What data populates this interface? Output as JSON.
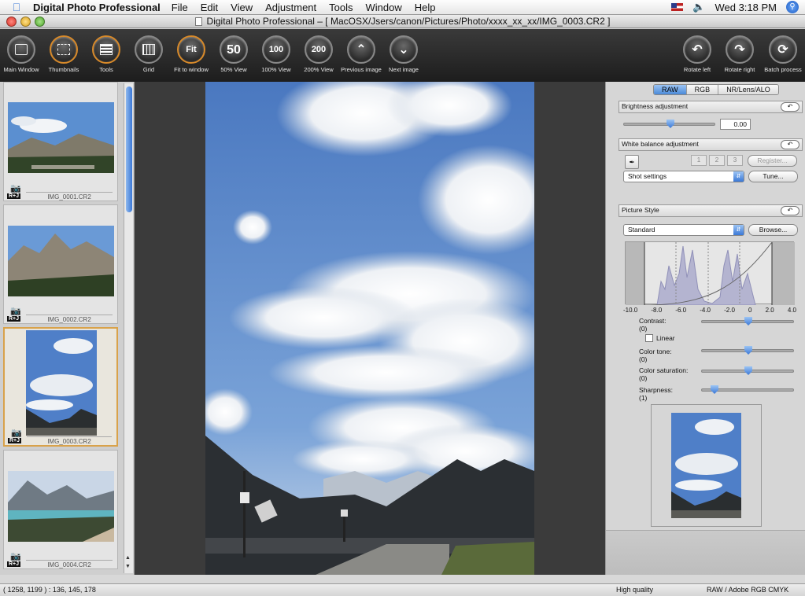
{
  "menubar": {
    "app_name": "Digital Photo Professional",
    "menus": [
      "File",
      "Edit",
      "View",
      "Adjustment",
      "Tools",
      "Window",
      "Help"
    ],
    "clock": "Wed 3:18 PM"
  },
  "window": {
    "title": "Digital Photo Professional – [ MacOSX/Jsers/canon/Pictures/Photo/xxxx_xx_xx/IMG_0003.CR2 ]"
  },
  "toolbar": {
    "main_window": "Main Window",
    "thumbnails": "Thumbnails",
    "tools": "Tools",
    "grid": "Grid",
    "fit_to_window": "Fit to window",
    "fit_glyph": "Fit",
    "view50": "50% View",
    "view50_glyph": "50",
    "view100": "100% View",
    "view100_glyph": "100",
    "view200": "200% View",
    "view200_glyph": "200",
    "previous_image": "Previous image",
    "next_image": "Next image",
    "rotate_left": "Rotate left",
    "rotate_right": "Rotate right",
    "batch_process": "Batch process"
  },
  "thumbnails": [
    {
      "filename": "IMG_0001.CR2",
      "badge": "R+J",
      "selected": false
    },
    {
      "filename": "IMG_0002.CR2",
      "badge": "R+J",
      "selected": false
    },
    {
      "filename": "IMG_0003.CR2",
      "badge": "R+J",
      "selected": true
    },
    {
      "filename": "IMG_0004.CR2",
      "badge": "R+J",
      "selected": false
    }
  ],
  "palette": {
    "tabs": [
      "RAW",
      "RGB",
      "NR/Lens/ALO"
    ],
    "active_tab": "RAW",
    "brightness": {
      "title": "Brightness adjustment",
      "value": "0.00",
      "level": 0.5
    },
    "white_balance": {
      "title": "White balance adjustment",
      "buttons": [
        "1",
        "2",
        "3"
      ],
      "register": "Register...",
      "mode": "Shot settings",
      "tune": "Tune..."
    },
    "picture_style": {
      "title": "Picture Style",
      "style": "Standard",
      "browse": "Browse...",
      "histogram_ticks": [
        "-10.0",
        "-8.0",
        "-6.0",
        "-4.0",
        "-2.0",
        "0",
        "2.0",
        "4.0"
      ],
      "contrast": {
        "label": "Contrast:",
        "value": "(0)",
        "level": 0.5
      },
      "linear": "Linear",
      "color_tone": {
        "label": "Color tone:",
        "value": "(0)",
        "level": 0.5
      },
      "color_saturation": {
        "label": "Color saturation:",
        "value": "(0)",
        "level": 0.5
      },
      "sharpness": {
        "label": "Sharpness:",
        "value": "(1)",
        "level": 0.1
      }
    }
  },
  "status": {
    "coords": "( 1258, 1199 ) : 136, 145, 178",
    "quality": "High quality",
    "color": "RAW / Adobe RGB  CMYK"
  },
  "colors": {
    "accent": "#3a78d6",
    "selection": "#d9a24a",
    "toolbar": "#262626"
  }
}
